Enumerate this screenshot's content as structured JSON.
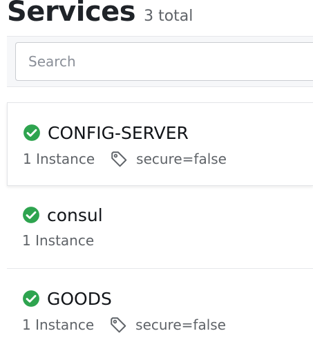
{
  "header": {
    "title": "Services",
    "total": "3 total"
  },
  "search": {
    "placeholder": "Search",
    "value": ""
  },
  "colors": {
    "passing": "#2ea44f"
  },
  "services": [
    {
      "name": "CONFIG-SERVER",
      "instances": "1 Instance",
      "tag": "secure=false",
      "status_icon": "check-circle-icon",
      "tag_icon": "tag-icon"
    },
    {
      "name": "consul",
      "instances": "1 Instance",
      "status_icon": "check-circle-icon"
    },
    {
      "name": "GOODS",
      "instances": "1 Instance",
      "tag": "secure=false",
      "status_icon": "check-circle-icon",
      "tag_icon": "tag-icon"
    }
  ]
}
